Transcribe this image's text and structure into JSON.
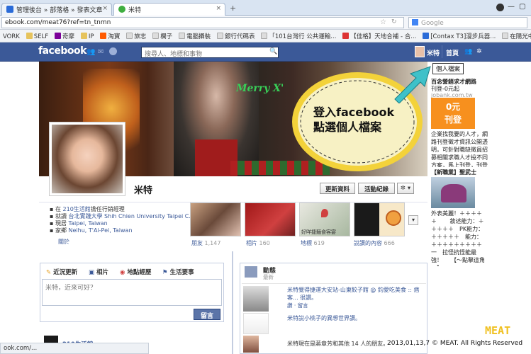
{
  "browser": {
    "tabs": [
      {
        "label": "管理後台 » 部落格 » 發表文章",
        "icon_color": "#2a6bd8"
      },
      {
        "label": "米特",
        "icon_color": "#3fae3f"
      }
    ],
    "new_tab": "+",
    "url": "ebook.com/meat76?ref=tn_tnmn",
    "search_placeholder": "Google",
    "bookmarks": [
      "VORK",
      "SELF",
      "奇摩",
      "IP",
      "淘寶",
      "旅志",
      "欄子",
      "電腦攝裝",
      "銀行代碼表",
      "「101台灣行 公共運輸...",
      "【佳格】天地合補 - 合...",
      "[Contax T3]漫步兵器...",
      "在陽光中品味書香一夢..."
    ]
  },
  "facebook": {
    "logo": "facebook",
    "search_placeholder": "搜尋人、地標和事物",
    "nav": {
      "user": "米特",
      "home": "首頁"
    },
    "cover_text": "Merry X'",
    "callout": {
      "line1": "登入facebook",
      "line2": "點選個人檔案"
    },
    "tooltip": "個人檔案",
    "profile_name": "米特",
    "buttons": {
      "update": "更新資料",
      "activity": "活動紀錄",
      "settings": "✲ ▾"
    },
    "info": [
      {
        "pre": "在",
        "link": "210生活館",
        "post": "擔任行銷經理"
      },
      {
        "pre": "就讀",
        "link": "台北實踐大學 Shih Chien University Taipei C...",
        "post": ""
      },
      {
        "pre": "現居",
        "link": "Taipei, Taiwan",
        "post": ""
      },
      {
        "pre": "家鄉",
        "link": "Neihu, T'Ai-Pei, Taiwan",
        "post": ""
      }
    ],
    "about": "關於",
    "sections": [
      {
        "label": "朋友",
        "count": "1,147"
      },
      {
        "label": "相片",
        "count": "160"
      },
      {
        "label": "地標",
        "count": "619"
      },
      {
        "label": "說讚的內容",
        "count": "666"
      }
    ],
    "thumb_caption": "好咩捷麵食客宴",
    "composer": {
      "tabs": [
        "近況更新",
        "相片",
        "地點經歷",
        "生活要事"
      ],
      "placeholder": "米特，近來可好？",
      "post": "留言"
    },
    "activity": {
      "title": "動態",
      "subtitle": "最新",
      "items": [
        {
          "text": "米特覺得捷運大安站-山東餃子館 @ 鈞愛吃美食 :: 痞客... 很讚。",
          "actions": "讚 · 留言"
        },
        {
          "text": "米特說小桃子的異想世界讚。",
          "actions": ""
        },
        {
          "text": "米特現在是蔣章芳和其他 14 人的朋友。",
          "actions": ""
        }
      ]
    },
    "sidebar_bottom": "210生活館"
  },
  "ads": {
    "ad1_title": "百念營銷求才網路",
    "ad1_sub": "刊登-0元起",
    "ad1_url": "jobank.com.tw",
    "ad1_badge_line1": "0元",
    "ad1_badge_line2": "刊登",
    "ad1_body": "企業找我要的人才，網路刊登徵才資訊公開透明，可針對職缺徵員招募相關求職人才投不同方案，馬上刊登，刊登只要0元起！",
    "ad2_title": "【新職業】聖武士",
    "ad2_body": "外表美麗！＋＋＋＋＋ 　　敘述能力：＋＋＋＋＋　PK能力：＋＋＋＋＋　能力：＋＋＋＋＋＋＋＋＋　一　拉怪抗怪能最強！　　【～點擊這角～】"
  },
  "watermark": "2013,01,13,7 © MEAT. All Rights Reserved",
  "logo_text": "MEAT",
  "status_bar": "ook.com/...",
  "colors": {
    "fb_blue": "#3b5998",
    "callout_fill": "#f7f1c4",
    "arrow": "#3fc1c9",
    "ad_badge": "#f7901e"
  }
}
